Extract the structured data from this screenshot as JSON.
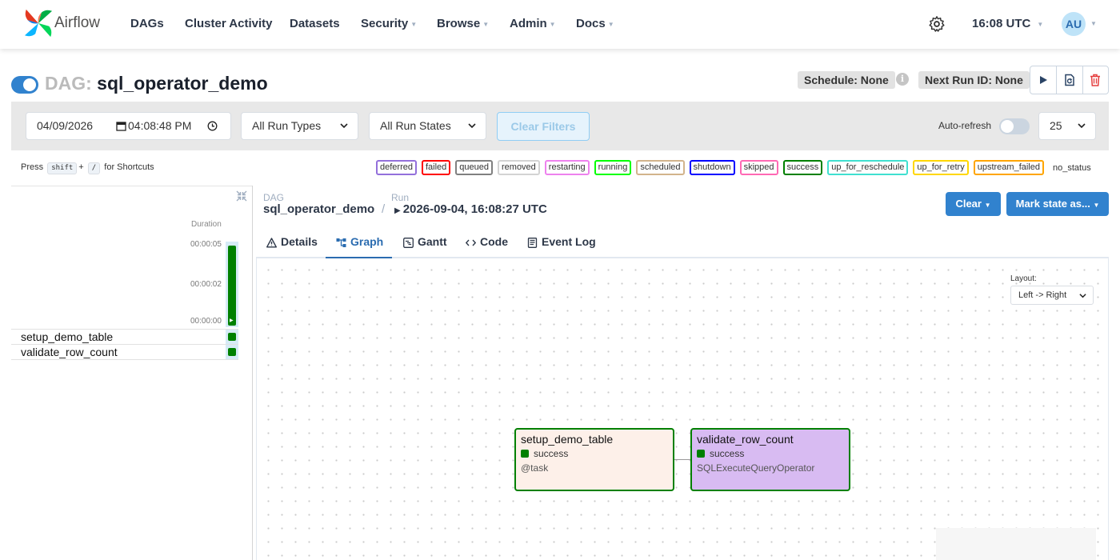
{
  "nav": {
    "brand": "Airflow",
    "items": [
      {
        "label": "DAGs",
        "dropdown": false
      },
      {
        "label": "Cluster Activity",
        "dropdown": false
      },
      {
        "label": "Datasets",
        "dropdown": false
      },
      {
        "label": "Security",
        "dropdown": true
      },
      {
        "label": "Browse",
        "dropdown": true
      },
      {
        "label": "Admin",
        "dropdown": true
      },
      {
        "label": "Docs",
        "dropdown": true
      }
    ],
    "time": "16:08 UTC",
    "avatar_initials": "AU"
  },
  "dag": {
    "prefix": "DAG:",
    "id": "sql_operator_demo",
    "schedule": "Schedule: None",
    "next_run": "Next Run ID: None"
  },
  "filters": {
    "date": "04/09/2026",
    "time": "04:08:48 PM",
    "run_types": "All Run Types",
    "run_states": "All Run States",
    "clear_label": "Clear Filters",
    "autorefresh_label": "Auto-refresh",
    "page_size": "25"
  },
  "shortcuts": {
    "press": "Press",
    "key1": "shift",
    "plus": "+",
    "key2": "/",
    "suffix": "for Shortcuts"
  },
  "legend": [
    {
      "label": "deferred",
      "color": "#9370db"
    },
    {
      "label": "failed",
      "color": "#ff0000"
    },
    {
      "label": "queued",
      "color": "#808080"
    },
    {
      "label": "removed",
      "color": "#d3d3d3"
    },
    {
      "label": "restarting",
      "color": "#ee82ee"
    },
    {
      "label": "running",
      "color": "#00ff00"
    },
    {
      "label": "scheduled",
      "color": "#d2b48c"
    },
    {
      "label": "shutdown",
      "color": "#0000ff"
    },
    {
      "label": "skipped",
      "color": "#ff69b4"
    },
    {
      "label": "success",
      "color": "#008000"
    },
    {
      "label": "up_for_reschedule",
      "color": "#40e0d0"
    },
    {
      "label": "up_for_retry",
      "color": "#ffd700"
    },
    {
      "label": "upstream_failed",
      "color": "#ffa500"
    }
  ],
  "legend_plain": "no_status",
  "grid": {
    "duration_label": "Duration",
    "ticks": [
      "00:00:05",
      "00:00:02",
      "00:00:00"
    ],
    "tasks": [
      "setup_demo_table",
      "validate_row_count"
    ],
    "success_color": "#008000"
  },
  "breadcrumb": {
    "dag_label": "DAG",
    "dag_value": "sql_operator_demo",
    "sep": "/",
    "run_label": "Run",
    "run_value": "2026-09-04, 16:08:27 UTC"
  },
  "buttons": {
    "clear": "Clear",
    "mark_state": "Mark state as..."
  },
  "tabs": [
    {
      "label": "Details",
      "icon": "warning-triangle-icon"
    },
    {
      "label": "Graph",
      "icon": "graph-icon",
      "active": true
    },
    {
      "label": "Gantt",
      "icon": "gantt-icon"
    },
    {
      "label": "Code",
      "icon": "code-icon"
    },
    {
      "label": "Event Log",
      "icon": "event-log-icon"
    }
  ],
  "graph": {
    "layout_label": "Layout:",
    "layout_value": "Left -> Right",
    "nodes": [
      {
        "name": "setup_demo_table",
        "state": "success",
        "operator": "@task",
        "bg": "#fdf0e9"
      },
      {
        "name": "validate_row_count",
        "state": "success",
        "operator": "SQLExecuteQueryOperator",
        "bg": "#d8bbf2"
      }
    ]
  }
}
